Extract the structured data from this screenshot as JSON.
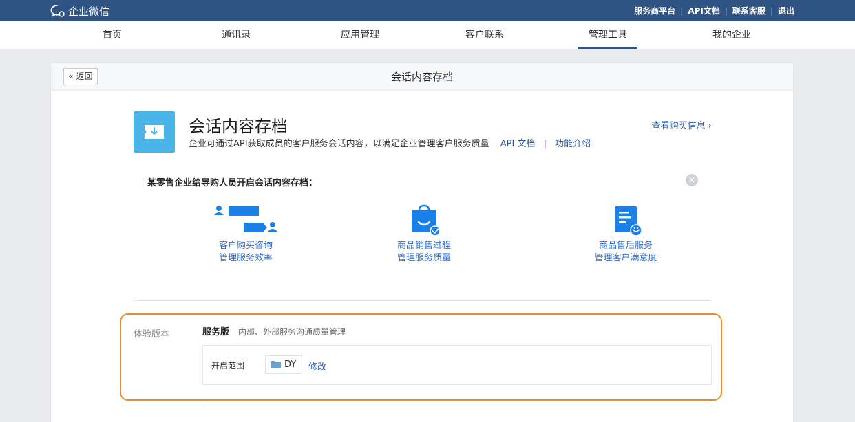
{
  "topbar": {
    "logo_text": "企业微信",
    "links": [
      "服务商平台",
      "API文档",
      "联系客服",
      "退出"
    ],
    "separator": "|"
  },
  "nav": {
    "items": [
      "首页",
      "通讯录",
      "应用管理",
      "客户联系",
      "管理工具",
      "我的企业"
    ],
    "active_index": 4
  },
  "page": {
    "back_label": "返回",
    "title": "会话内容存档"
  },
  "app": {
    "name": "会话内容存档",
    "description": "企业可通过API获取成员的客户服务会话内容，以满足企业管理客户服务质量",
    "api_link": "API 文档",
    "link_sep": "|",
    "intro_link": "功能介绍",
    "buy_link": "查看购买信息"
  },
  "case": {
    "title": "某零售企业给导购人员开启会话内容存档：",
    "features": [
      {
        "icon": "chat-users-icon",
        "line1": "客户购买咨询",
        "line2": "管理服务效率"
      },
      {
        "icon": "shopping-bag-icon",
        "line1": "商品销售过程",
        "line2": "管理服务质量"
      },
      {
        "icon": "document-smile-icon",
        "line1": "商品售后服务",
        "line2": "管理客户满意度"
      }
    ]
  },
  "version": {
    "label": "体验版本",
    "name": "服务版",
    "desc": "内部、外部服务沟通质量管理",
    "scope_label": "开启范围",
    "scope_value": "DY",
    "edit_label": "修改"
  },
  "colors": {
    "topbar": "#2f5484",
    "link": "#2f5ca8",
    "feature_blue": "#1a7fe6",
    "app_icon": "#4ab3e8",
    "highlight": "#f08a24"
  }
}
